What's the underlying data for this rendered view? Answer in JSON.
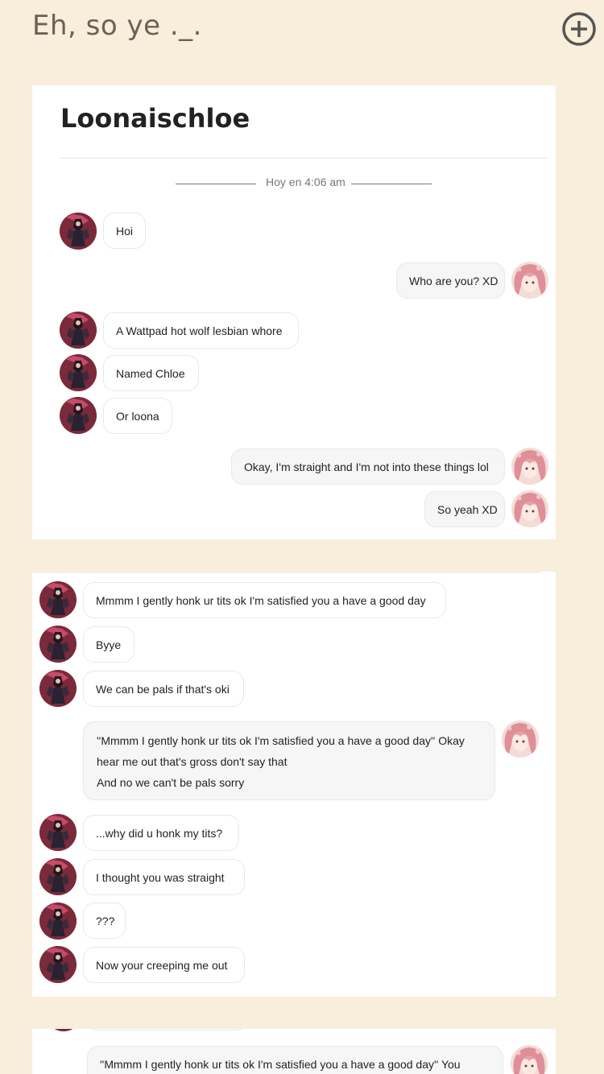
{
  "header": {
    "title": "Eh, so ye ._.",
    "add_icon": "plus-circle-icon"
  },
  "card1": {
    "title": "Loonaischloe",
    "timestamp": "Hoy en 4:06 am",
    "messages": [
      {
        "side": "in",
        "text": "Hoi"
      },
      {
        "side": "out",
        "text": "Who are you? XD"
      },
      {
        "side": "in",
        "text": "A Wattpad  hot wolf lesbian whore"
      },
      {
        "side": "in",
        "text": "Named Chloe"
      },
      {
        "side": "in",
        "text": "Or loona"
      },
      {
        "side": "out",
        "text": "Okay, I'm straight and I'm not into these things lol"
      },
      {
        "side": "out",
        "text": "So yeah XD"
      }
    ]
  },
  "card2": {
    "messages": [
      {
        "side": "in",
        "text": "Mmmm I gently honk ur tits ok I'm satisfied you a have a good day"
      },
      {
        "side": "in",
        "text": "Byye"
      },
      {
        "side": "in",
        "text": "We can be pals if that's oki"
      },
      {
        "side": "out",
        "lines": [
          "''Mmmm I gently honk ur tits ok I'm satisfied you a have a good day'' Okay",
          "hear me out that's gross don't say that",
          "And no we can't be pals sorry"
        ]
      },
      {
        "side": "in",
        "text": "...why did u honk my tits?"
      },
      {
        "side": "in",
        "text": "I thought you was straight"
      },
      {
        "side": "in",
        "text": "???"
      },
      {
        "side": "in",
        "text": "Now your creeping me out"
      }
    ]
  },
  "card3": {
    "messages": [
      {
        "side": "out",
        "text": "''Mmmm I gently honk ur tits ok I'm satisfied you a have a good day'' You"
      }
    ]
  },
  "colors": {
    "background": "#f8eedb",
    "card": "#ffffff",
    "bubble_border": "#e8e8e8",
    "bubble_out": "#f6f6f6",
    "avatar_in": "#7a2a3a",
    "avatar_out": "#e8a4a8"
  }
}
